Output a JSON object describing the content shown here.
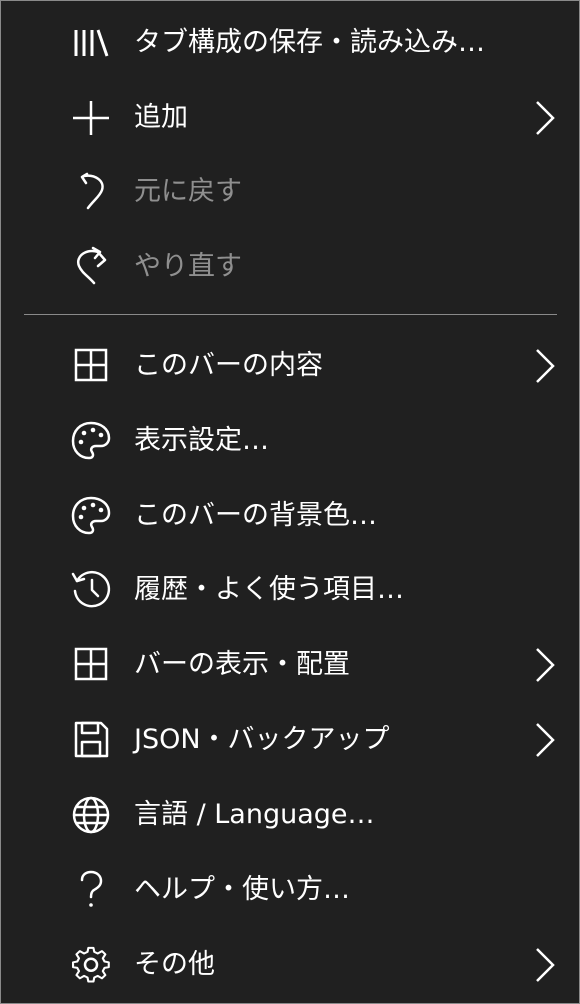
{
  "menu": {
    "items": [
      {
        "label": "タブ構成の保存・読み込み…",
        "icon": "library-icon"
      },
      {
        "label": "追加",
        "icon": "plus-icon",
        "submenu": true
      },
      {
        "label": "元に戻す",
        "icon": "undo-icon",
        "disabled": true
      },
      {
        "label": "やり直す",
        "icon": "redo-icon",
        "disabled": true
      },
      {
        "label": "このバーの内容",
        "icon": "grid-icon",
        "submenu": true
      },
      {
        "label": "表示設定…",
        "icon": "palette-icon"
      },
      {
        "label": "このバーの背景色…",
        "icon": "palette-icon"
      },
      {
        "label": "履歴・よく使う項目…",
        "icon": "history-icon"
      },
      {
        "label": "バーの表示・配置",
        "icon": "grid-icon",
        "submenu": true
      },
      {
        "label": "JSON・バックアップ",
        "icon": "save-icon",
        "submenu": true
      },
      {
        "label": "言語 / Language…",
        "icon": "globe-icon"
      },
      {
        "label": "ヘルプ・使い方…",
        "icon": "question-icon"
      },
      {
        "label": "その他",
        "icon": "gear-icon",
        "submenu": true
      }
    ]
  },
  "colors": {
    "background": "#202020",
    "text": "#ffffff",
    "disabled_text": "#8f8f8f",
    "separator": "#8a8a8a"
  }
}
